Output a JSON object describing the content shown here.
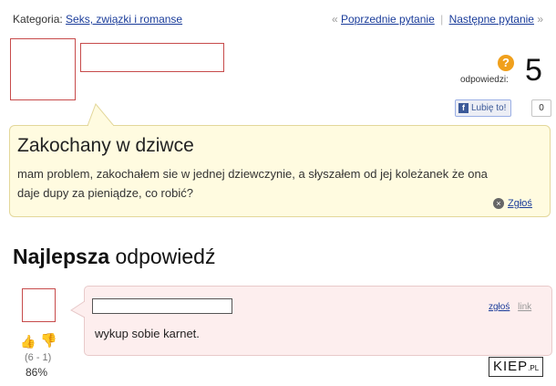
{
  "category": {
    "label": "Kategoria:",
    "value": "Seks, związki i romanse"
  },
  "nav": {
    "prev_arrow": "«",
    "prev": "Poprzednie pytanie",
    "separator": "|",
    "next": "Następne pytanie",
    "next_arrow": "»"
  },
  "answers": {
    "icon_glyph": "?",
    "label": "odpowiedzi:",
    "count": "5"
  },
  "facebook": {
    "icon_glyph": "f",
    "like_label": "Lubię to!",
    "count": "0"
  },
  "question": {
    "title": "Zakochany w dziwce",
    "body": "mam problem, zakochałem sie w jednej dziewczynie, a słyszałem od jej koleżanek że ona daje dupy za pieniądze, co robić?",
    "report_icon": "×",
    "report_label": "Zgłoś"
  },
  "best_answer": {
    "heading_bold": "Najlepsza",
    "heading_rest": "odpowiedź",
    "report_label": "zgłoś",
    "link_label": "link",
    "text": "wykup sobie karnet.",
    "votes_detail": "(6 - 1)",
    "votes_percent": "86%"
  },
  "watermark": {
    "main": "KIEP",
    "suffix": ".PL"
  },
  "colors": {
    "accent_link": "#1a3c9a",
    "question_bg": "#fffbe0",
    "answer_bg": "#fdeeee",
    "avatar_border": "#c74b4b"
  }
}
